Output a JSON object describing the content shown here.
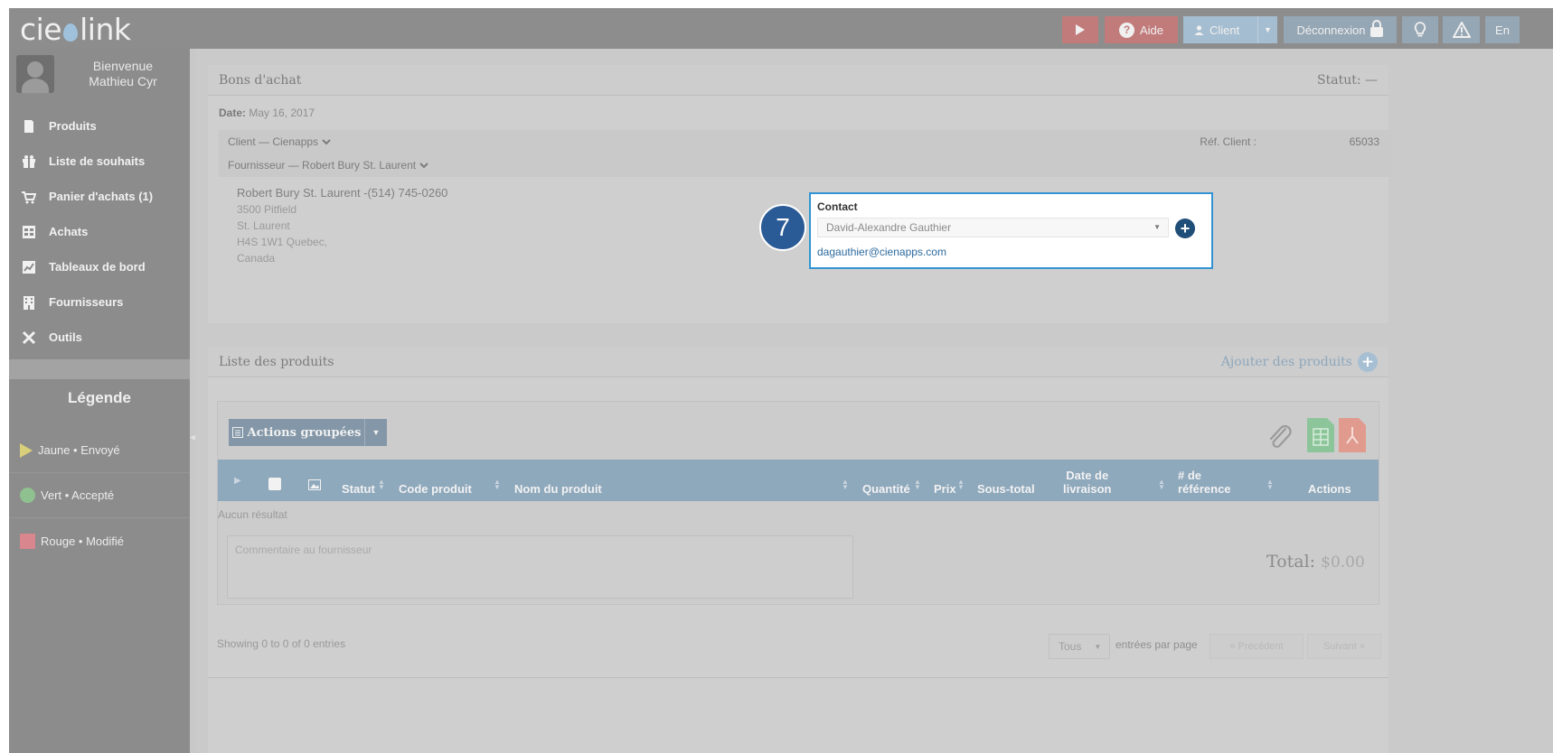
{
  "app": {
    "logo_left": "cie",
    "logo_right": "link"
  },
  "topbar": {
    "help_label": "Aide",
    "client_label": "Client",
    "logout_label": "Déconnexion",
    "lang_label": "En"
  },
  "sidebar": {
    "welcome_line1": "Bienvenue",
    "welcome_line2": "Mathieu Cyr",
    "items": [
      {
        "label": "Produits",
        "icon": "document-icon"
      },
      {
        "label": "Liste de souhaits",
        "icon": "gift-icon"
      },
      {
        "label": "Panier d'achats (1)",
        "icon": "cart-icon"
      },
      {
        "label": "Achats",
        "icon": "purchases-icon"
      },
      {
        "label": "Tableaux de bord",
        "icon": "dashboard-icon"
      },
      {
        "label": "Fournisseurs",
        "icon": "building-icon"
      },
      {
        "label": "Outils",
        "icon": "tools-icon"
      }
    ],
    "legend_title": "Légende",
    "legend": [
      {
        "label": "Jaune • Envoyé",
        "color": "#d9cf7a"
      },
      {
        "label": "Vert • Accepté",
        "color": "#8fc08f"
      },
      {
        "label": "Rouge • Modifié",
        "color": "#d9868f"
      }
    ]
  },
  "po": {
    "title": "Bons d'achat",
    "status": "Statut: —",
    "date_label": "Date:",
    "date_value": "May 16, 2017",
    "client_row": "Client — Cienapps",
    "ref_label": "Réf. Client :",
    "ref_value": "65033",
    "supplier_row": "Fournisseur — Robert Bury St. Laurent",
    "address": {
      "name": "Robert Bury St. Laurent -(514) 745-0260",
      "line1": "3500 Pitfield",
      "line2": "St. Laurent",
      "line3": "H4S 1W1 Quebec,",
      "line4": "Canada"
    },
    "contact": {
      "label": "Contact",
      "selected": "David-Alexandre Gauthier",
      "email": "dagauthier@cienapps.com"
    },
    "step_number": "7"
  },
  "products": {
    "title": "Liste des produits",
    "add_label": "Ajouter des produits",
    "group_actions": "Actions groupées",
    "columns": {
      "status": "Statut",
      "code": "Code produit",
      "name": "Nom du produit",
      "qty": "Quantité",
      "price": "Prix",
      "subtotal": "Sous-total",
      "delivery1": "Date de",
      "delivery2": "livraison",
      "ref1": "# de",
      "ref2": "référence",
      "actions": "Actions"
    },
    "no_result": "Aucun résultat",
    "comment_placeholder": "Commentaire au fournisseur",
    "total_label": "Total:",
    "total_value": "$0.00",
    "showing": "Showing 0 to 0 of 0 entries",
    "page_size": "Tous",
    "page_size_label": "entrées par page",
    "prev_label": "« Précédent",
    "next_label": "Suivant »"
  }
}
